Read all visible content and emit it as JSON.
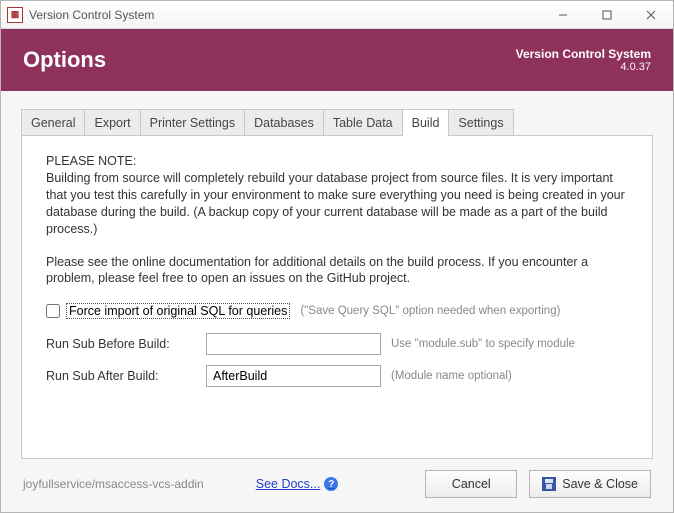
{
  "window": {
    "title": "Version Control System"
  },
  "header": {
    "title": "Options",
    "appname": "Version Control System",
    "version": "4.0.37"
  },
  "tabs": {
    "items": [
      {
        "label": "General"
      },
      {
        "label": "Export"
      },
      {
        "label": "Printer Settings"
      },
      {
        "label": "Databases"
      },
      {
        "label": "Table Data"
      },
      {
        "label": "Build"
      },
      {
        "label": "Settings"
      }
    ],
    "activeIndex": 5
  },
  "build": {
    "noteTitle": "PLEASE NOTE:",
    "noteBody": "Building from source will completely rebuild your database project from source files. It is very important that you test this carefully in your environment to make sure everything you need is being created in your database during the build. (A backup copy of your current database will be made as a part of the build process.)",
    "noteBody2": "Please see the online documentation for additional details on the build process. If you encounter a problem, please feel free to open an issues on the GitHub project.",
    "forceImportLabel": "Force import of original SQL for queries",
    "forceImportHint": "(\"Save Query SQL\" option needed when exporting)",
    "beforeLabel": "Run Sub Before Build:",
    "beforeValue": "",
    "beforeHint": "Use \"module.sub\" to specify module",
    "afterLabel": "Run Sub After Build:",
    "afterValue": "AfterBuild",
    "afterHint": "(Module name optional)"
  },
  "footer": {
    "repo": "joyfullservice/msaccess-vcs-addin",
    "docs": "See Docs...",
    "cancel": "Cancel",
    "save": "Save & Close"
  }
}
